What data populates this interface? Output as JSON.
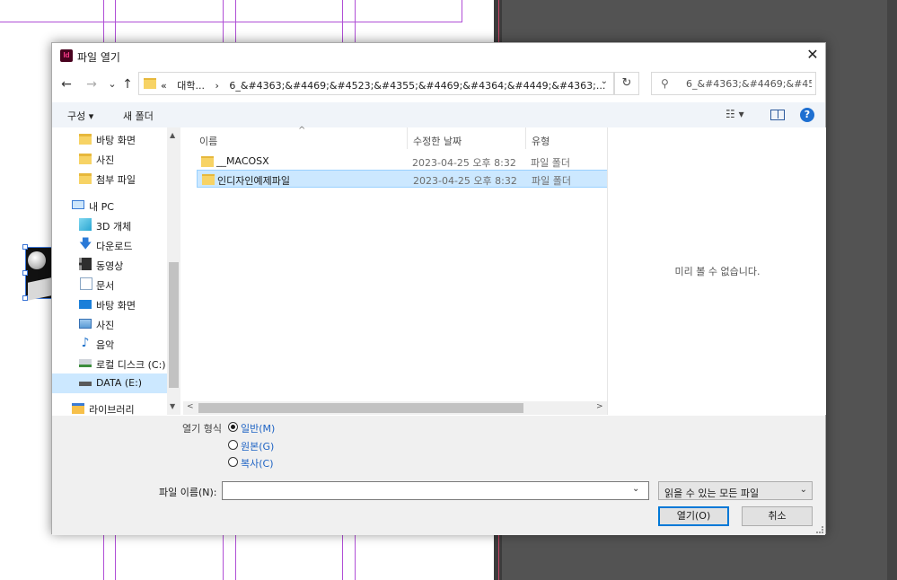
{
  "dialog": {
    "title": "파일 열기",
    "app_icon": "Id",
    "close_glyph": "✕"
  },
  "nav": {
    "back": "←",
    "forward": "→",
    "recent": "⌄",
    "up": "↑",
    "address": {
      "prefix": "«",
      "segments": [
        "대학...",
        "›",
        "6_&#4363;&#4469;&#4523;&#4355;&#4469;&#4364;&#4449;&#4363;..."
      ],
      "dropdown": "⌄"
    },
    "refresh": "↻",
    "search": {
      "icon": "⚲",
      "placeholder": "6_&#4363;&#4469;&#452..."
    }
  },
  "toolbar": {
    "organize": "구성 ▾",
    "new_folder": "새 폴더",
    "view_glyph": "☷ ▾",
    "help": "?"
  },
  "sidebar": {
    "items": [
      {
        "label": "바탕 화면",
        "icon": "folder-icon"
      },
      {
        "label": "사진",
        "icon": "folder-icon"
      },
      {
        "label": "첨부 파일",
        "icon": "folder-icon"
      },
      {
        "label": "내 PC",
        "icon": "pc-icon"
      },
      {
        "label": "3D 개체",
        "icon": "3d-objects-icon"
      },
      {
        "label": "다운로드",
        "icon": "download-icon"
      },
      {
        "label": "동영상",
        "icon": "video-icon"
      },
      {
        "label": "문서",
        "icon": "document-icon"
      },
      {
        "label": "바탕 화면",
        "icon": "desktop-icon"
      },
      {
        "label": "사진",
        "icon": "pictures-icon"
      },
      {
        "label": "음악",
        "icon": "music-icon"
      },
      {
        "label": "로컬 디스크 (C:)",
        "icon": "local-disk-icon"
      },
      {
        "label": "DATA (E:)",
        "icon": "drive-icon"
      },
      {
        "label": "라이브러리",
        "icon": "library-icon"
      }
    ],
    "scroll_up": "▲",
    "scroll_down": "▼"
  },
  "filelist": {
    "columns": {
      "name": "이름",
      "date": "수정한 날짜",
      "type": "유형"
    },
    "sort_glyph": "^",
    "rows": [
      {
        "name": "__MACOSX",
        "date": "2023-04-25 오후 8:32",
        "type": "파일 폴더"
      },
      {
        "name": "인디자인예제파일",
        "date": "2023-04-25 오후 8:32",
        "type": "파일 폴더"
      }
    ],
    "scroll_left": "<",
    "scroll_right": ">"
  },
  "preview": {
    "message": "미리 볼 수 없습니다."
  },
  "open_as": {
    "label": "열기 형식",
    "options": [
      {
        "label": "일반(M)",
        "selected": true
      },
      {
        "label": "원본(G)",
        "selected": false
      },
      {
        "label": "복사(C)",
        "selected": false
      }
    ]
  },
  "filename": {
    "label": "파일 이름(N):",
    "value": "",
    "dropdown": "⌄"
  },
  "filter": {
    "value": "읽을 수 있는 모든 파일",
    "dropdown": "⌄"
  },
  "buttons": {
    "open": "열기(O)",
    "cancel": "취소"
  }
}
